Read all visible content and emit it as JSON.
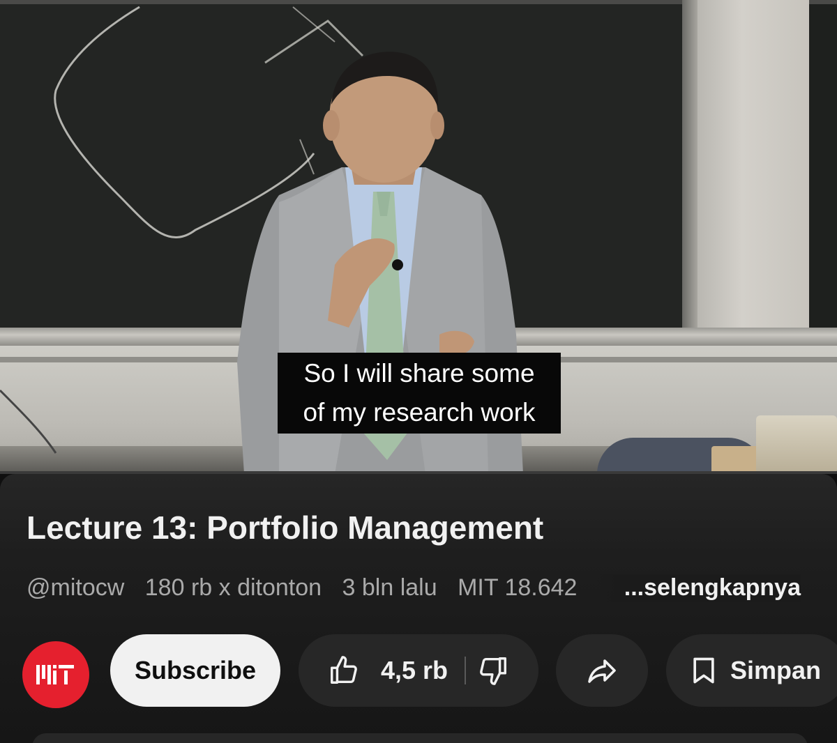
{
  "video": {
    "caption_lines": [
      "So I will share some",
      "of my research work"
    ],
    "progress_fraction": 0.0
  },
  "info": {
    "title": "Lecture 13: Portfolio Management",
    "channel_handle": "@mitocw",
    "views": "180 rb x ditonton",
    "age": "3 bln lalu",
    "tag": "MIT 18.642",
    "more_label": "...selengkapnya"
  },
  "actions": {
    "channel_logo_text": "MIT",
    "subscribe_label": "Subscribe",
    "like_count": "4,5 rb",
    "save_label": "Simpan"
  },
  "colors": {
    "background": "#0f0f0f",
    "pill": "#272727",
    "subscribe_bg": "#f1f1f1",
    "avatar": "#e5202e",
    "caption_bg": "#080808"
  },
  "icons": [
    "thumbs-up-icon",
    "thumbs-down-icon",
    "share-icon",
    "bookmark-icon",
    "mit-logo-icon"
  ]
}
